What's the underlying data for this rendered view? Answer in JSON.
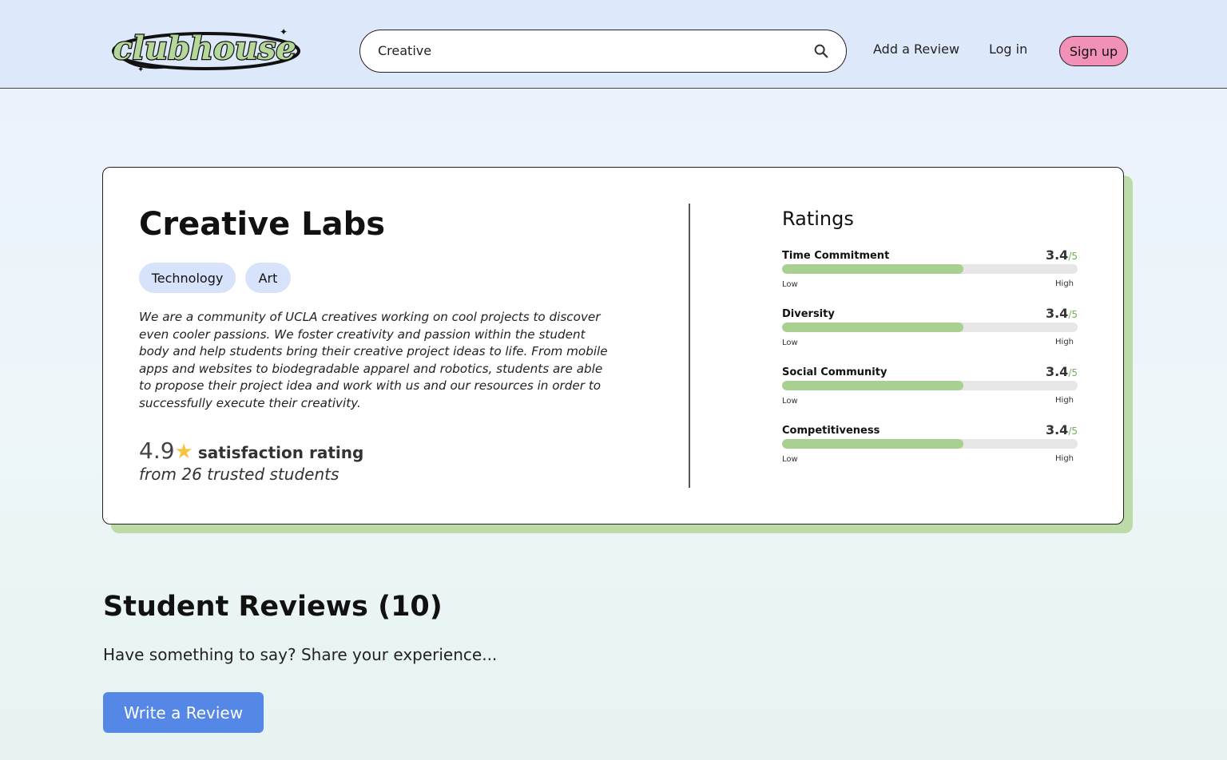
{
  "header": {
    "logo_text": "clubhouse",
    "search": {
      "value": "Creative",
      "placeholder": ""
    },
    "nav": {
      "add_review": "Add a Review",
      "login": "Log in",
      "signup": "Sign up"
    }
  },
  "club": {
    "name": "Creative Labs",
    "tags": [
      "Technology",
      "Art"
    ],
    "description": "We are a community of UCLA creatives working on cool projects to discover even cooler passions. We foster creativity and passion within the student body and help students bring their creative project ideas to life. From mobile apps and websites to biodegradable apparel and robotics, students are able to propose their project idea and work with us and our resources in order to successfully execute their creativity.",
    "satisfaction": {
      "score": "4.9",
      "star": "★",
      "label": "satisfaction rating",
      "sub": "from 26 trusted students"
    }
  },
  "ratings": {
    "heading": "Ratings",
    "items": [
      {
        "name": "Time Commitment",
        "score": "3.4",
        "outof": "/5",
        "fraction": 0.613,
        "low": "Low",
        "high": "High"
      },
      {
        "name": "Diversity",
        "score": "3.4",
        "outof": "/5",
        "fraction": 0.613,
        "low": "Low",
        "high": "High"
      },
      {
        "name": "Social Community",
        "score": "3.4",
        "outof": "/5",
        "fraction": 0.613,
        "low": "Low",
        "high": "High"
      },
      {
        "name": "Competitiveness",
        "score": "3.4",
        "outof": "/5",
        "fraction": 0.613,
        "low": "Low",
        "high": "High"
      }
    ]
  },
  "reviews": {
    "title": "Student Reviews (10)",
    "prompt": "Have something to say? Share your experience...",
    "write_button": "Write a Review"
  },
  "colors": {
    "header_bg": "#dde8fb",
    "accent_green": "#a8d090",
    "card_shadow": "#bcdba9",
    "signup_pink": "#f291b8",
    "tag_blue": "#d6e3fb",
    "button_blue": "#5588e6",
    "star": "#f5c542"
  },
  "icons": {
    "search": "search-icon",
    "star": "star-icon"
  }
}
